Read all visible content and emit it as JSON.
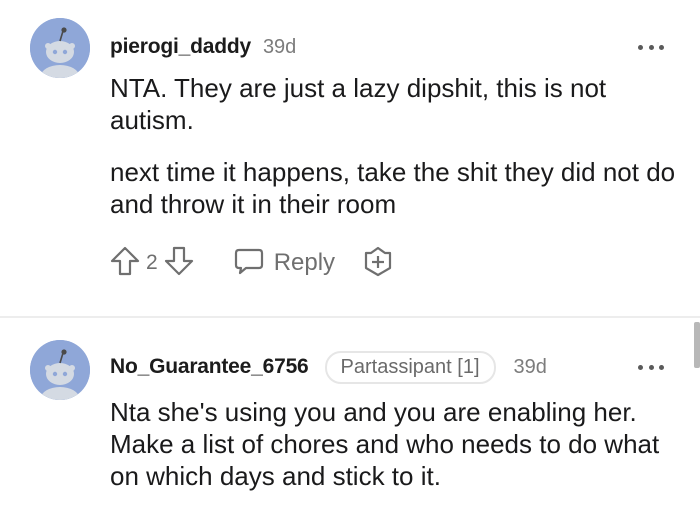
{
  "colors": {
    "avatar_bg": "#8fa7d8",
    "text": "#1a1a1b",
    "muted": "#7c7c7c",
    "divider": "#ededed"
  },
  "comments": [
    {
      "username": "pierogi_daddy",
      "age": "39d",
      "body": [
        "NTA. They are just a lazy dipshit, this is not autism.",
        "next time it happens, take the shit they did not do and throw it in their room"
      ],
      "vote_count": "2",
      "reply_label": "Reply",
      "icons": {
        "avatar": "reddit-snoo-avatar-icon",
        "more": "more-options-icon",
        "upvote": "upvote-arrow-icon",
        "downvote": "downvote-arrow-icon",
        "reply": "speech-bubble-icon",
        "award": "award-plus-icon"
      }
    },
    {
      "username": "No_Guarantee_6756",
      "flair": "Partassipant [1]",
      "age": "39d",
      "body": [
        "Nta she's using you and you are enabling her. Make a list of chores and who needs to do what on which days and stick to it."
      ],
      "icons": {
        "avatar": "reddit-snoo-avatar-icon",
        "more": "more-options-icon"
      }
    }
  ]
}
